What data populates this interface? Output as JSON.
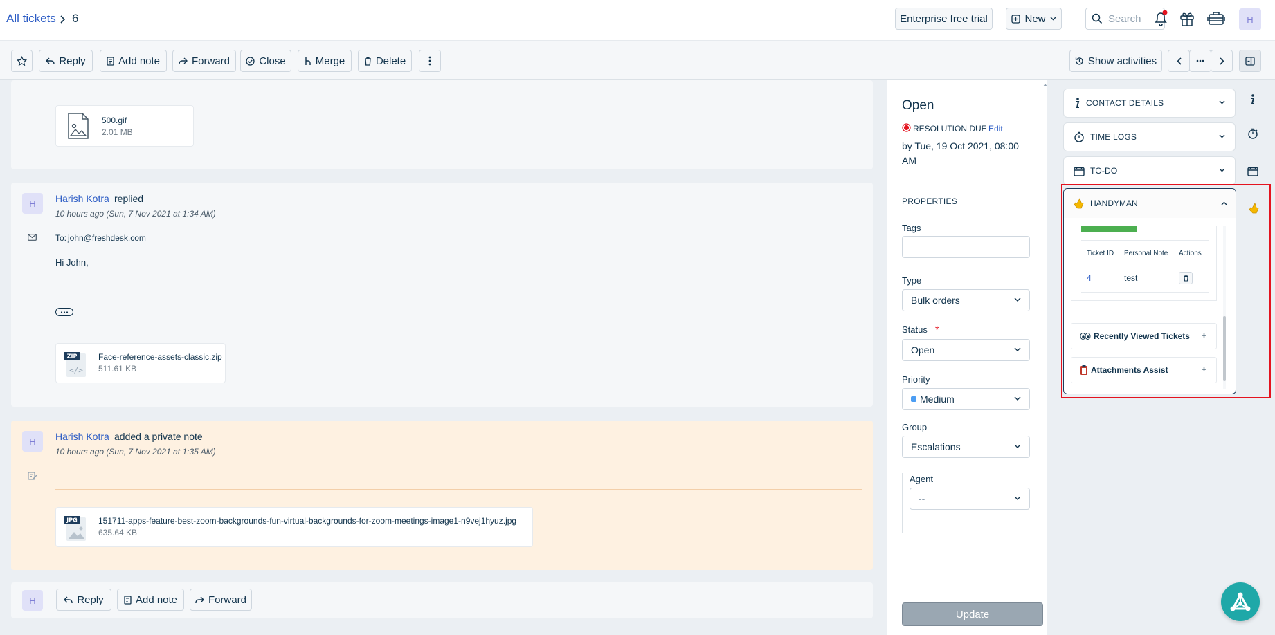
{
  "header": {
    "breadcrumb_link": "All tickets",
    "ticket_number": "6",
    "trial_button": "Enterprise free trial",
    "new_button": "New",
    "search_placeholder": "Search",
    "avatar_initial": "H"
  },
  "toolbar": {
    "reply": "Reply",
    "add_note": "Add note",
    "forward": "Forward",
    "close": "Close",
    "merge": "Merge",
    "delete": "Delete",
    "show_activities": "Show activities"
  },
  "conversation": {
    "attachment_top": {
      "name": "500.gif",
      "size": "2.01 MB"
    },
    "reply_msg": {
      "avatar": "H",
      "author": "Harish Kotra",
      "action": "replied",
      "time": "10 hours ago (Sun, 7 Nov 2021 at 1:34 AM)",
      "to_label": "To:",
      "to_email": "john@freshdesk.com",
      "body": "Hi John,",
      "attachment": {
        "badge": "ZIP",
        "name": "Face-reference-assets-classic.zip",
        "size": "511.61 KB"
      }
    },
    "note_msg": {
      "avatar": "H",
      "author": "Harish Kotra",
      "action": "added a private note",
      "time": "10 hours ago (Sun, 7 Nov 2021 at 1:35 AM)",
      "attachment": {
        "badge": "JPG",
        "name": "151711-apps-feature-best-zoom-backgrounds-fun-virtual-backgrounds-for-zoom-meetings-image1-n9vej1hyuz.jpg",
        "size": "635.64 KB"
      }
    },
    "bottom_bar": {
      "avatar": "H",
      "reply": "Reply",
      "add_note": "Add note",
      "forward": "Forward"
    }
  },
  "properties": {
    "status_title": "Open",
    "resolution_due": "RESOLUTION DUE",
    "edit": "Edit",
    "due_by": "by Tue, 19 Oct 2021, 08:00 AM",
    "section_title": "PROPERTIES",
    "tags_label": "Tags",
    "type_label": "Type",
    "type_value": "Bulk orders",
    "status_label": "Status",
    "required_mark": "*",
    "status_value": "Open",
    "priority_label": "Priority",
    "priority_value": "Medium",
    "priority_color": "#4d9ef3",
    "group_label": "Group",
    "group_value": "Escalations",
    "agent_label": "Agent",
    "agent_value": "--",
    "update_button": "Update"
  },
  "apps": {
    "contact_details": "CONTACT DETAILS",
    "time_logs": "TIME LOGS",
    "todo": "TO-DO",
    "handyman": {
      "title": "HANDYMAN",
      "table_headers": [
        "Ticket ID",
        "Personal Note",
        "Actions"
      ],
      "rows": [
        {
          "ticket_id": "4",
          "note": "test"
        }
      ],
      "recently_viewed": "Recently Viewed Tickets",
      "attachments_assist": "Attachments Assist",
      "plus": "+"
    }
  },
  "colors": {
    "link": "#2c5cc5",
    "highlight_border": "#e4131f",
    "green_bar": "#4caf50",
    "note_bg": "#fef1e1",
    "fab": "#1fa8a8"
  }
}
